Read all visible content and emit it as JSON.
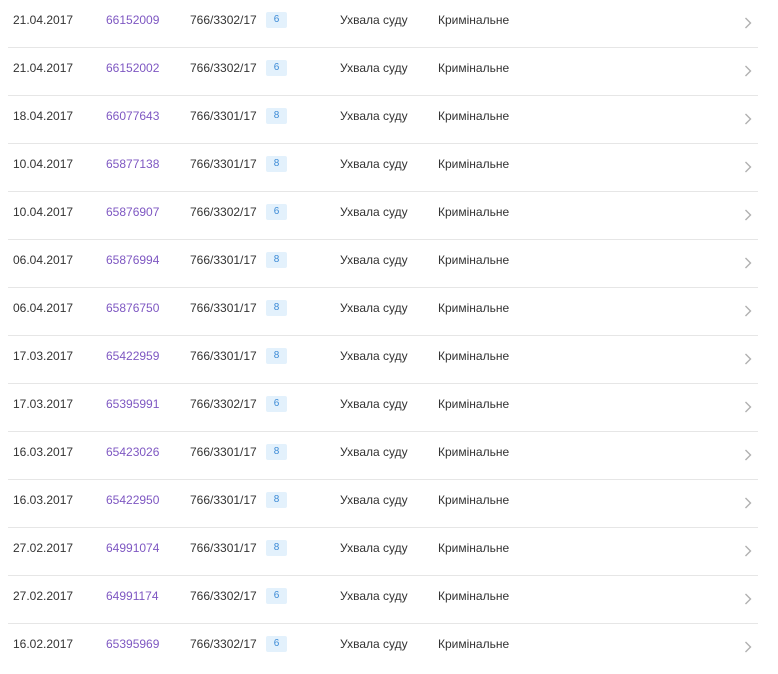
{
  "rows": [
    {
      "date": "21.04.2017",
      "doc_id": "66152009",
      "case_no": "766/3302/17",
      "badge": "6",
      "doc_type": "Ухвала суду",
      "category": "Кримінальне"
    },
    {
      "date": "21.04.2017",
      "doc_id": "66152002",
      "case_no": "766/3302/17",
      "badge": "6",
      "doc_type": "Ухвала суду",
      "category": "Кримінальне"
    },
    {
      "date": "18.04.2017",
      "doc_id": "66077643",
      "case_no": "766/3301/17",
      "badge": "8",
      "doc_type": "Ухвала суду",
      "category": "Кримінальне"
    },
    {
      "date": "10.04.2017",
      "doc_id": "65877138",
      "case_no": "766/3301/17",
      "badge": "8",
      "doc_type": "Ухвала суду",
      "category": "Кримінальне"
    },
    {
      "date": "10.04.2017",
      "doc_id": "65876907",
      "case_no": "766/3302/17",
      "badge": "6",
      "doc_type": "Ухвала суду",
      "category": "Кримінальне"
    },
    {
      "date": "06.04.2017",
      "doc_id": "65876994",
      "case_no": "766/3301/17",
      "badge": "8",
      "doc_type": "Ухвала суду",
      "category": "Кримінальне"
    },
    {
      "date": "06.04.2017",
      "doc_id": "65876750",
      "case_no": "766/3301/17",
      "badge": "8",
      "doc_type": "Ухвала суду",
      "category": "Кримінальне"
    },
    {
      "date": "17.03.2017",
      "doc_id": "65422959",
      "case_no": "766/3301/17",
      "badge": "8",
      "doc_type": "Ухвала суду",
      "category": "Кримінальне"
    },
    {
      "date": "17.03.2017",
      "doc_id": "65395991",
      "case_no": "766/3302/17",
      "badge": "6",
      "doc_type": "Ухвала суду",
      "category": "Кримінальне"
    },
    {
      "date": "16.03.2017",
      "doc_id": "65423026",
      "case_no": "766/3301/17",
      "badge": "8",
      "doc_type": "Ухвала суду",
      "category": "Кримінальне"
    },
    {
      "date": "16.03.2017",
      "doc_id": "65422950",
      "case_no": "766/3301/17",
      "badge": "8",
      "doc_type": "Ухвала суду",
      "category": "Кримінальне"
    },
    {
      "date": "27.02.2017",
      "doc_id": "64991074",
      "case_no": "766/3301/17",
      "badge": "8",
      "doc_type": "Ухвала суду",
      "category": "Кримінальне"
    },
    {
      "date": "27.02.2017",
      "doc_id": "64991174",
      "case_no": "766/3302/17",
      "badge": "6",
      "doc_type": "Ухвала суду",
      "category": "Кримінальне"
    },
    {
      "date": "16.02.2017",
      "doc_id": "65395969",
      "case_no": "766/3302/17",
      "badge": "6",
      "doc_type": "Ухвала суду",
      "category": "Кримінальне"
    }
  ],
  "icons": {
    "row_arrow": "chevron-right-icon"
  },
  "colors": {
    "link": "#7e57c2",
    "badge_text": "#3b8ad6",
    "badge_bg": "#e3f1fc",
    "divider": "#e6e6e6",
    "text": "#333333",
    "chevron": "#b0b0b0"
  }
}
